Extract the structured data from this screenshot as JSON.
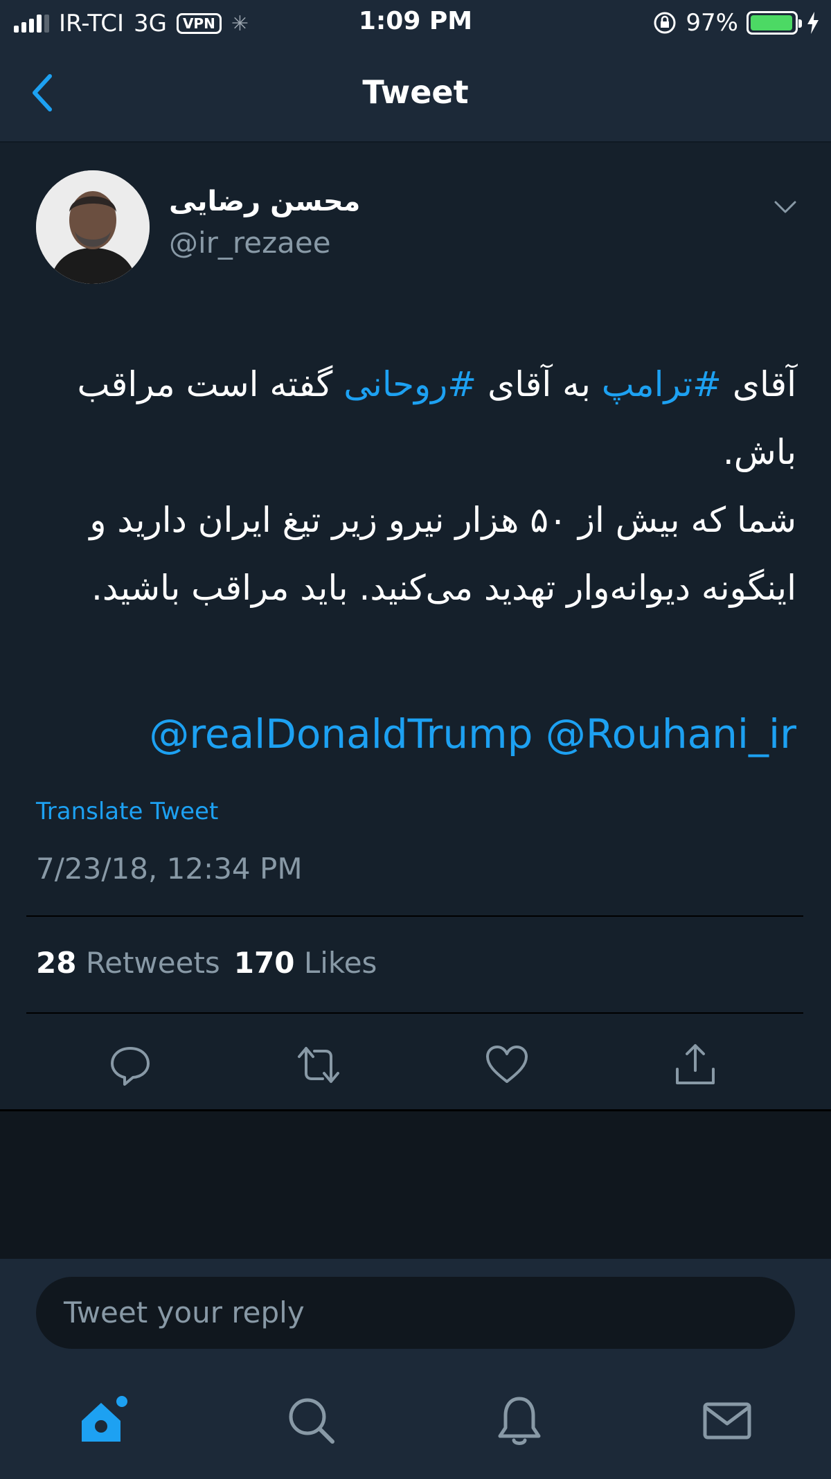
{
  "status_bar": {
    "carrier": "IR-TCI",
    "network": "3G",
    "vpn": "VPN",
    "time": "1:09 PM",
    "battery": "97%",
    "battery_level": 0.97
  },
  "nav": {
    "title": "Tweet"
  },
  "tweet": {
    "author_name": "محسن رضایی",
    "author_handle": "@ir_rezaee",
    "text_parts": {
      "p1": "آقای ",
      "h1": "#ترامپ",
      "p2": " به آقای ",
      "h2": "#روحانی",
      "p3": " گفته است مراقب باش.",
      "line2": "شما که بیش از ۵۰ هزار نیرو زیر تیغ ایران دارید و اینگونه دیوانه‌وار تهدید می‌کنید. باید مراقب باشید."
    },
    "mentions": "@realDonaldTrump @Rouhani_ir",
    "translate_label": "Translate Tweet",
    "timestamp": "7/23/18, 12:34 PM",
    "retweets_count": "28",
    "retweets_label": "Retweets",
    "likes_count": "170",
    "likes_label": "Likes"
  },
  "reply": {
    "placeholder": "Tweet your reply"
  },
  "colors": {
    "background": "#15202b",
    "accent": "#1da1f2",
    "muted": "#8899a6"
  },
  "icons": {
    "back": "chevron-left-icon",
    "menu": "chevron-down-icon",
    "reply": "reply-icon",
    "retweet": "retweet-icon",
    "like": "heart-icon",
    "share": "share-icon",
    "home": "home-icon",
    "search": "search-icon",
    "notifications": "bell-icon",
    "messages": "mail-icon"
  }
}
